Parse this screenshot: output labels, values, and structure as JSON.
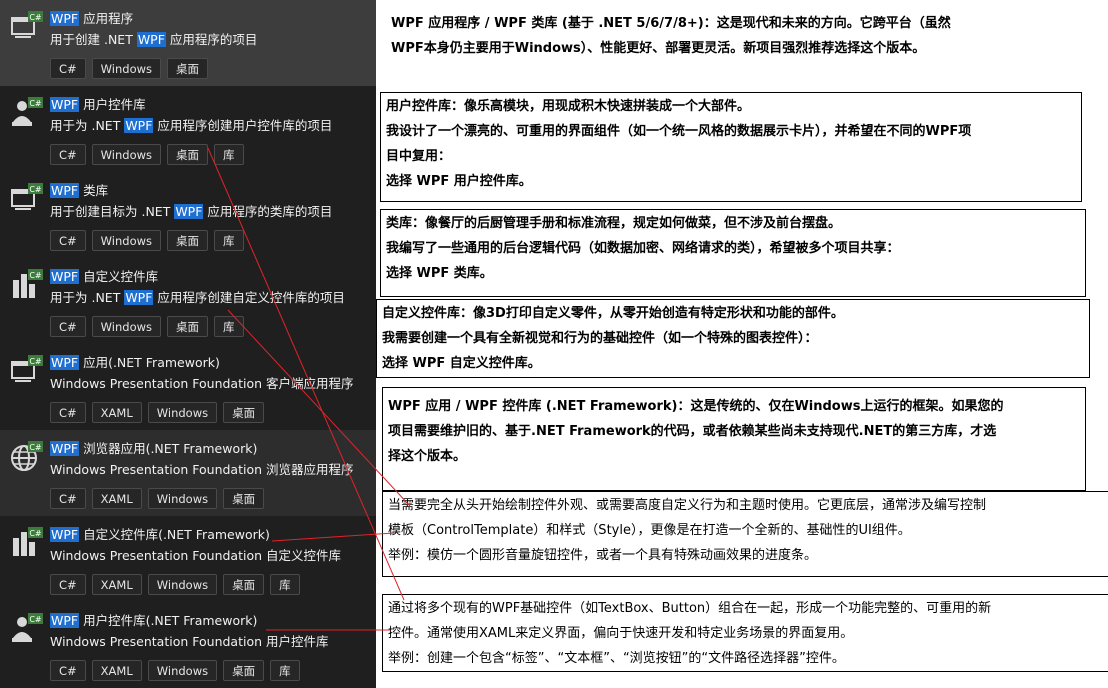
{
  "templates": [
    {
      "title_hl": "WPF",
      "title_rest": " 应用程序",
      "desc_pre": "用于创建 .NET ",
      "desc_hl": "WPF",
      "desc_post": " 应用程序的项目",
      "tags": [
        "C#",
        "Windows",
        "桌面"
      ],
      "icon": "wpf-app-icon",
      "badge": "C#"
    },
    {
      "title_hl": "WPF",
      "title_rest": " 用户控件库",
      "desc_pre": "用于为 .NET ",
      "desc_hl": "WPF",
      "desc_post": " 应用程序创建用户控件库的项目",
      "tags": [
        "C#",
        "Windows",
        "桌面",
        "库"
      ],
      "icon": "user-control-library-icon",
      "badge": "C#"
    },
    {
      "title_hl": "WPF",
      "title_rest": " 类库",
      "desc_pre": "用于创建目标为 .NET ",
      "desc_hl": "WPF",
      "desc_post": " 应用程序的类库的项目",
      "tags": [
        "C#",
        "Windows",
        "桌面",
        "库"
      ],
      "icon": "class-library-icon",
      "badge": "C#"
    },
    {
      "title_hl": "WPF",
      "title_rest": " 自定义控件库",
      "desc_pre": "用于为 .NET ",
      "desc_hl": "WPF",
      "desc_post": " 应用程序创建自定义控件库的项目",
      "tags": [
        "C#",
        "Windows",
        "桌面",
        "库"
      ],
      "icon": "custom-control-library-icon",
      "badge": "C#"
    },
    {
      "title_hl": "WPF",
      "title_rest": " 应用(.NET Framework)",
      "desc_pre": "Windows Presentation Foundation 客户端应用程序",
      "desc_hl": "",
      "desc_post": "",
      "tags": [
        "C#",
        "XAML",
        "Windows",
        "桌面"
      ],
      "icon": "wpf-app-icon",
      "badge": "C#"
    },
    {
      "title_hl": "WPF",
      "title_rest": " 浏览器应用(.NET Framework)",
      "desc_pre": "Windows Presentation Foundation 浏览器应用程序",
      "desc_hl": "",
      "desc_post": "",
      "tags": [
        "C#",
        "XAML",
        "Windows",
        "桌面"
      ],
      "icon": "globe-icon",
      "badge": "C#"
    },
    {
      "title_hl": "WPF",
      "title_rest": " 自定义控件库(.NET Framework)",
      "desc_pre": "Windows Presentation Foundation 自定义控件库",
      "desc_hl": "",
      "desc_post": "",
      "tags": [
        "C#",
        "XAML",
        "Windows",
        "桌面",
        "库"
      ],
      "icon": "custom-control-library-icon",
      "badge": "C#"
    },
    {
      "title_hl": "WPF",
      "title_rest": " 用户控件库(.NET Framework)",
      "desc_pre": "Windows Presentation Foundation 用户控件库",
      "desc_hl": "",
      "desc_post": "",
      "tags": [
        "C#",
        "XAML",
        "Windows",
        "桌面",
        "库"
      ],
      "icon": "user-control-library-icon",
      "badge": "C#"
    }
  ],
  "notes": {
    "n1": {
      "l1": "WPF 应用程序 / WPF 类库 (基于 .NET 5/6/7/8+)：这是现代和未来的方向。它跨平台（虽然",
      "l2": "WPF本身仍主要用于Windows）、性能更好、部署更灵活。新项目强烈推荐选择这个版本。"
    },
    "n2": {
      "l1": "用户控件库：像乐高模块，用现成积木快速拼装成一个大部件。",
      "l2": "我设计了一个漂亮的、可重用的界面组件（如一个统一风格的数据展示卡片），并希望在不同的WPF项",
      "l3": "目中复用：",
      "l4": "选择 WPF 用户控件库。"
    },
    "n3": {
      "l1": "类库：像餐厅的后厨管理手册和标准流程，规定如何做菜，但不涉及前台摆盘。",
      "l2": "我编写了一些通用的后台逻辑代码（如数据加密、网络请求的类），希望被多个项目共享：",
      "l3": "选择 WPF 类库。"
    },
    "n4": {
      "l1": "自定义控件库：像3D打印自定义零件，从零开始创造有特定形状和功能的部件。",
      "l2": "我需要创建一个具有全新视觉和行为的基础控件（如一个特殊的图表控件）：",
      "l3": "选择 WPF 自定义控件库。"
    },
    "n5": {
      "l1": "WPF 应用 / WPF 控件库 (.NET Framework)：这是传统的、仅在Windows上运行的框架。如果您的",
      "l2": "项目需要维护旧的、基于.NET Framework的代码，或者依赖某些尚未支持现代.NET的第三方库，才选",
      "l3": "择这个版本。"
    },
    "n6": {
      "l1": "当需要完全从头开始绘制控件外观、或需要高度自定义行为和主题时使用。它更底层，通常涉及编写控制",
      "l2": "模板（ControlTemplate）和样式（Style），更像是在打造一个全新的、基础性的UI组件。",
      "l3": "举例：模仿一个圆形音量旋钮控件，或者一个具有特殊动画效果的进度条。"
    },
    "n7": {
      "l1": "通过将多个现有的WPF基础控件（如TextBox、Button）组合在一起，形成一个功能完整的、可重用的新",
      "l2": "控件。通常使用XAML来定义界面，偏向于快速开发和特定业务场景的界面复用。",
      "l3": "举例：创建一个包含“标签”、“文本框”、“浏览按钮”的“文件路径选择器”控件。"
    }
  },
  "colors": {
    "panel": "#1f1f1f",
    "selected": "#3d3d3d",
    "highlight": "#1f6fd0",
    "line": "#e0242b"
  }
}
